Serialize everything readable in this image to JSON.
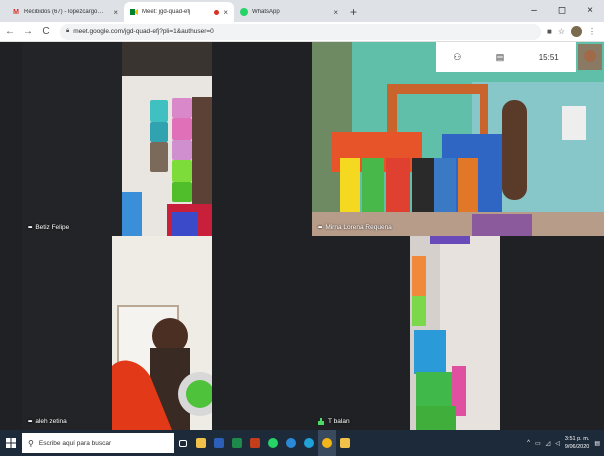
{
  "tabs": [
    {
      "icon": "gmail-icon",
      "label": "Recibidos (67) - lopezcargo@gm",
      "close": "×",
      "active": false
    },
    {
      "icon": "meet-icon",
      "label": "Meet: jgd-quad-efj",
      "close": "×",
      "active": true,
      "recording": true
    },
    {
      "icon": "whatsapp-icon",
      "label": "WhatsApp",
      "close": "×",
      "active": false
    }
  ],
  "newtab": "+",
  "window": {
    "minimize": "–",
    "maximize": "◻",
    "close": "×"
  },
  "nav": {
    "back": "←",
    "forward": "→",
    "reload": "C",
    "url": "meet.google.com/jgd-quad-efj?pli=1&authuser=0"
  },
  "meet": {
    "clock": "15:51",
    "participants": [
      {
        "name": "Betiz Felipe",
        "speaking": false
      },
      {
        "name": "Mirna Lorena Requena",
        "speaking": false
      },
      {
        "name": "aleh zetina",
        "speaking": false
      },
      {
        "name": "T balan",
        "speaking": true
      }
    ]
  },
  "taskbar": {
    "search_placeholder": "Escribe aquí para buscar",
    "time": "3:51 p. m.",
    "date": "9/06/2020"
  },
  "colors": {
    "meet_bg": "#202124",
    "tabbar": "#dee1e6",
    "taskbar": "#1d2a3a"
  }
}
